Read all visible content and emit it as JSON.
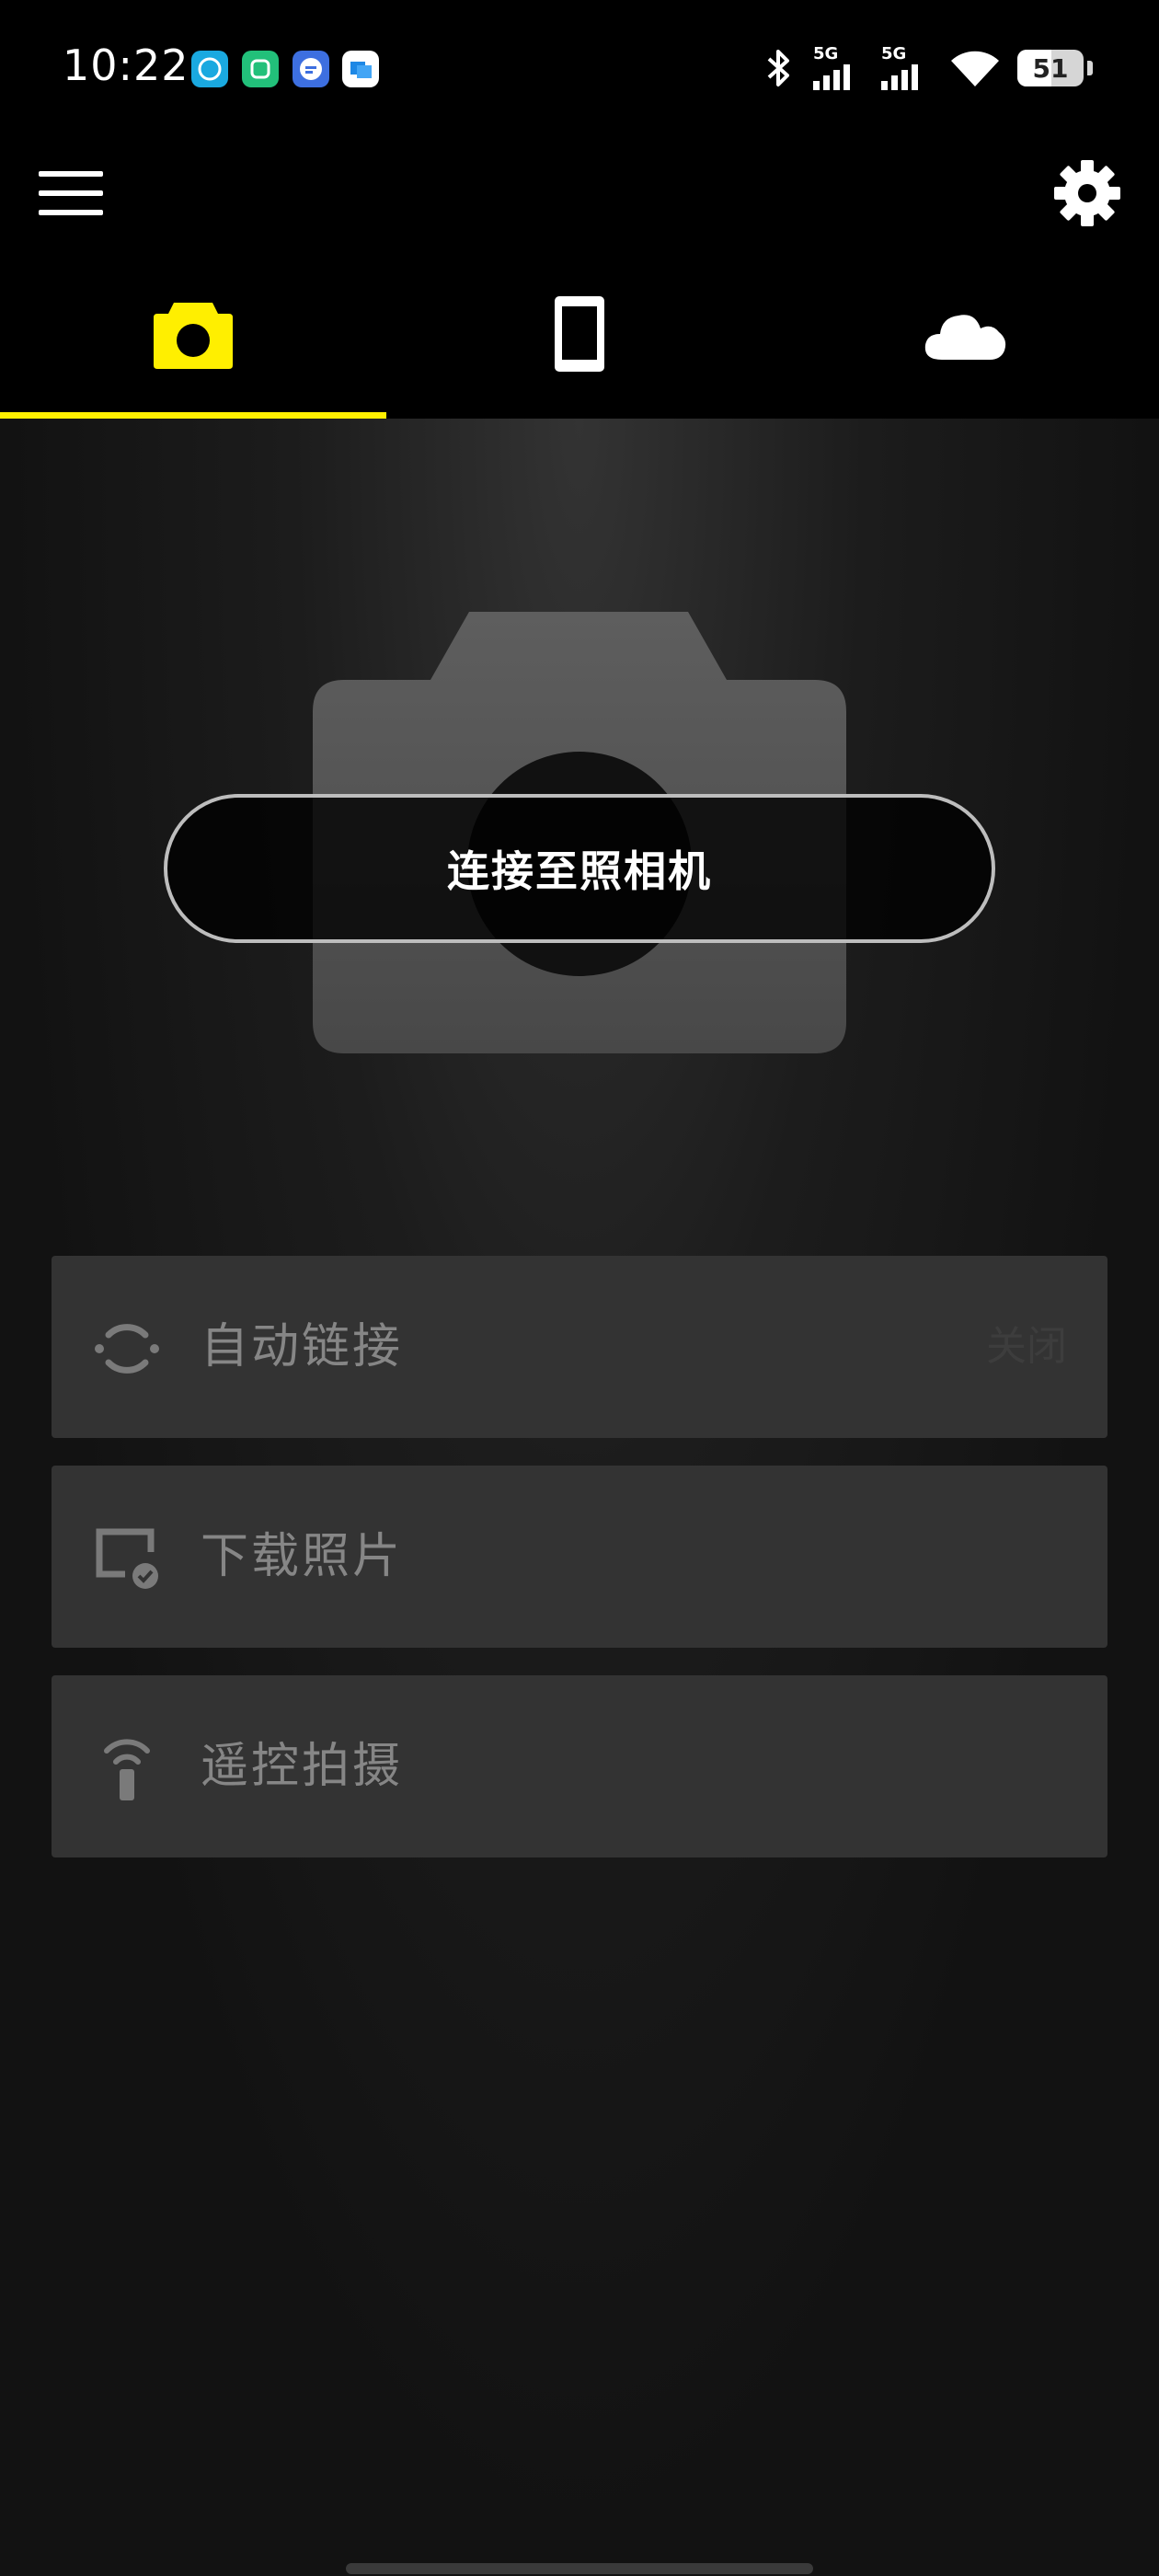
{
  "status_bar": {
    "time": "10:22",
    "notification_icons": [
      "app-icon-1",
      "app-icon-2",
      "app-icon-3",
      "app-icon-4"
    ],
    "signal_labels": [
      "5G",
      "5G"
    ],
    "battery_level": "51"
  },
  "header": {
    "menu_icon": "hamburger-menu-icon",
    "settings_icon": "gear-icon"
  },
  "tabs": [
    {
      "icon": "camera-icon",
      "active": true
    },
    {
      "icon": "phone-icon",
      "active": false
    },
    {
      "icon": "cloud-icon",
      "active": false
    }
  ],
  "main": {
    "connect_button_label": "连接至照相机",
    "items": [
      {
        "icon": "auto-link-icon",
        "label": "自动链接",
        "state": "关闭"
      },
      {
        "icon": "download-photo-icon",
        "label": "下载照片"
      },
      {
        "icon": "remote-shoot-icon",
        "label": "遥控拍摄"
      }
    ]
  },
  "colors": {
    "accent": "#ffef00",
    "background": "#121212",
    "item_background": "#333333",
    "item_text": "#868686"
  }
}
